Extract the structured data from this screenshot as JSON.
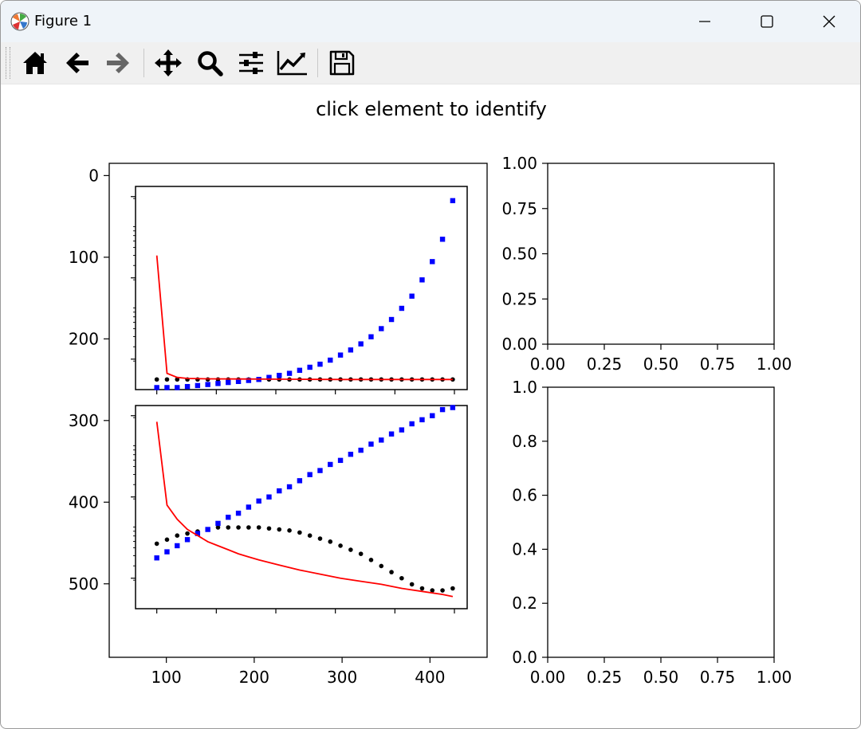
{
  "window": {
    "title": "Figure 1",
    "controls": [
      "minimize",
      "maximize",
      "close"
    ]
  },
  "toolbar": {
    "buttons": [
      {
        "name": "home",
        "icon": "home-icon"
      },
      {
        "name": "back",
        "icon": "arrow-left-icon"
      },
      {
        "name": "forward",
        "icon": "arrow-right-icon",
        "disabled": true
      },
      {
        "name": "pan",
        "icon": "move-icon"
      },
      {
        "name": "zoom",
        "icon": "magnifier-icon"
      },
      {
        "name": "subplots",
        "icon": "sliders-icon"
      },
      {
        "name": "edit-axes",
        "icon": "line-chart-icon"
      },
      {
        "name": "save",
        "icon": "floppy-disk-icon"
      }
    ]
  },
  "figure": {
    "suptitle": "click element to identify"
  },
  "chart_data": [
    {
      "id": "big-axes",
      "type": "line",
      "xlim": [
        35,
        465
      ],
      "ylim": [
        590,
        -15
      ],
      "y_inverted": true,
      "xticks": [
        "100",
        "200",
        "300",
        "400"
      ],
      "yticks": [
        "0",
        "100",
        "200",
        "300",
        "400",
        "500"
      ]
    },
    {
      "id": "inset-top",
      "type": "line",
      "xlim": [
        55,
        445
      ],
      "y_scale": "log",
      "series": [
        {
          "marker": "dot",
          "color": "#000000",
          "x": [
            80,
            92,
            104,
            116,
            128,
            140,
            152,
            164,
            176,
            188,
            200,
            212,
            224,
            236,
            248,
            260,
            272,
            284,
            296,
            308,
            320,
            332,
            344,
            356,
            368,
            380,
            392,
            404,
            416,
            428
          ],
          "yrel": [
            0.05,
            0.05,
            0.05,
            0.05,
            0.05,
            0.05,
            0.05,
            0.05,
            0.05,
            0.05,
            0.05,
            0.05,
            0.05,
            0.05,
            0.05,
            0.05,
            0.05,
            0.05,
            0.05,
            0.05,
            0.05,
            0.05,
            0.05,
            0.05,
            0.05,
            0.05,
            0.05,
            0.05,
            0.05,
            0.05
          ]
        },
        {
          "marker": "square",
          "color": "#0000ff",
          "x": [
            80,
            92,
            104,
            116,
            128,
            140,
            152,
            164,
            176,
            188,
            200,
            212,
            224,
            236,
            248,
            260,
            272,
            284,
            296,
            308,
            320,
            332,
            344,
            356,
            368,
            380,
            392,
            404,
            416,
            428
          ],
          "yrel": [
            0.01,
            0.01,
            0.01,
            0.015,
            0.02,
            0.025,
            0.03,
            0.035,
            0.04,
            0.045,
            0.05,
            0.06,
            0.07,
            0.08,
            0.095,
            0.11,
            0.125,
            0.145,
            0.17,
            0.195,
            0.225,
            0.26,
            0.3,
            0.345,
            0.4,
            0.46,
            0.54,
            0.63,
            0.74,
            0.93
          ]
        },
        {
          "marker": "none",
          "color": "#ff0000",
          "x": [
            80,
            92,
            104,
            116,
            140,
            180,
            240,
            300,
            360,
            428
          ],
          "yrel": [
            0.66,
            0.08,
            0.06,
            0.055,
            0.053,
            0.052,
            0.051,
            0.05,
            0.05,
            0.05
          ]
        }
      ]
    },
    {
      "id": "inset-bottom",
      "type": "line",
      "xlim": [
        55,
        445
      ],
      "y_scale": "log",
      "series": [
        {
          "marker": "dot",
          "color": "#000000",
          "x": [
            80,
            92,
            104,
            116,
            128,
            140,
            152,
            164,
            176,
            188,
            200,
            212,
            224,
            236,
            248,
            260,
            272,
            284,
            296,
            308,
            320,
            332,
            344,
            356,
            368,
            380,
            392,
            404,
            416,
            428
          ],
          "yrel": [
            0.32,
            0.34,
            0.36,
            0.37,
            0.38,
            0.39,
            0.4,
            0.4,
            0.4,
            0.4,
            0.4,
            0.395,
            0.39,
            0.385,
            0.375,
            0.36,
            0.345,
            0.33,
            0.31,
            0.29,
            0.27,
            0.24,
            0.21,
            0.18,
            0.15,
            0.12,
            0.1,
            0.09,
            0.09,
            0.1
          ]
        },
        {
          "marker": "square",
          "color": "#0000ff",
          "x": [
            80,
            92,
            104,
            116,
            128,
            140,
            152,
            164,
            176,
            188,
            200,
            212,
            224,
            236,
            248,
            260,
            272,
            284,
            296,
            308,
            320,
            332,
            344,
            356,
            368,
            380,
            392,
            404,
            416,
            428
          ],
          "yrel": [
            0.25,
            0.28,
            0.31,
            0.34,
            0.37,
            0.39,
            0.42,
            0.45,
            0.47,
            0.5,
            0.53,
            0.55,
            0.58,
            0.6,
            0.63,
            0.66,
            0.68,
            0.71,
            0.73,
            0.76,
            0.78,
            0.81,
            0.83,
            0.86,
            0.88,
            0.91,
            0.93,
            0.95,
            0.98,
            0.99
          ]
        },
        {
          "marker": "none",
          "color": "#ff0000",
          "x": [
            80,
            92,
            104,
            116,
            128,
            140,
            152,
            164,
            176,
            188,
            200,
            224,
            248,
            272,
            296,
            320,
            344,
            368,
            392,
            416,
            428
          ],
          "yrel": [
            0.92,
            0.51,
            0.44,
            0.39,
            0.36,
            0.33,
            0.31,
            0.29,
            0.27,
            0.255,
            0.24,
            0.215,
            0.19,
            0.17,
            0.15,
            0.135,
            0.12,
            0.1,
            0.085,
            0.07,
            0.06
          ]
        }
      ]
    },
    {
      "id": "axes-top-right",
      "type": "line",
      "xlim": [
        0,
        1
      ],
      "ylim": [
        0,
        1
      ],
      "xticks": [
        "0.00",
        "0.25",
        "0.50",
        "0.75",
        "1.00"
      ],
      "yticks": [
        "0.00",
        "0.25",
        "0.50",
        "0.75",
        "1.00"
      ]
    },
    {
      "id": "axes-bottom-right",
      "type": "line",
      "xlim": [
        0,
        1
      ],
      "ylim": [
        0,
        1
      ],
      "xticks": [
        "0.00",
        "0.25",
        "0.50",
        "0.75",
        "1.00"
      ],
      "yticks": [
        "0.0",
        "0.2",
        "0.4",
        "0.6",
        "0.8",
        "1.0"
      ]
    }
  ]
}
